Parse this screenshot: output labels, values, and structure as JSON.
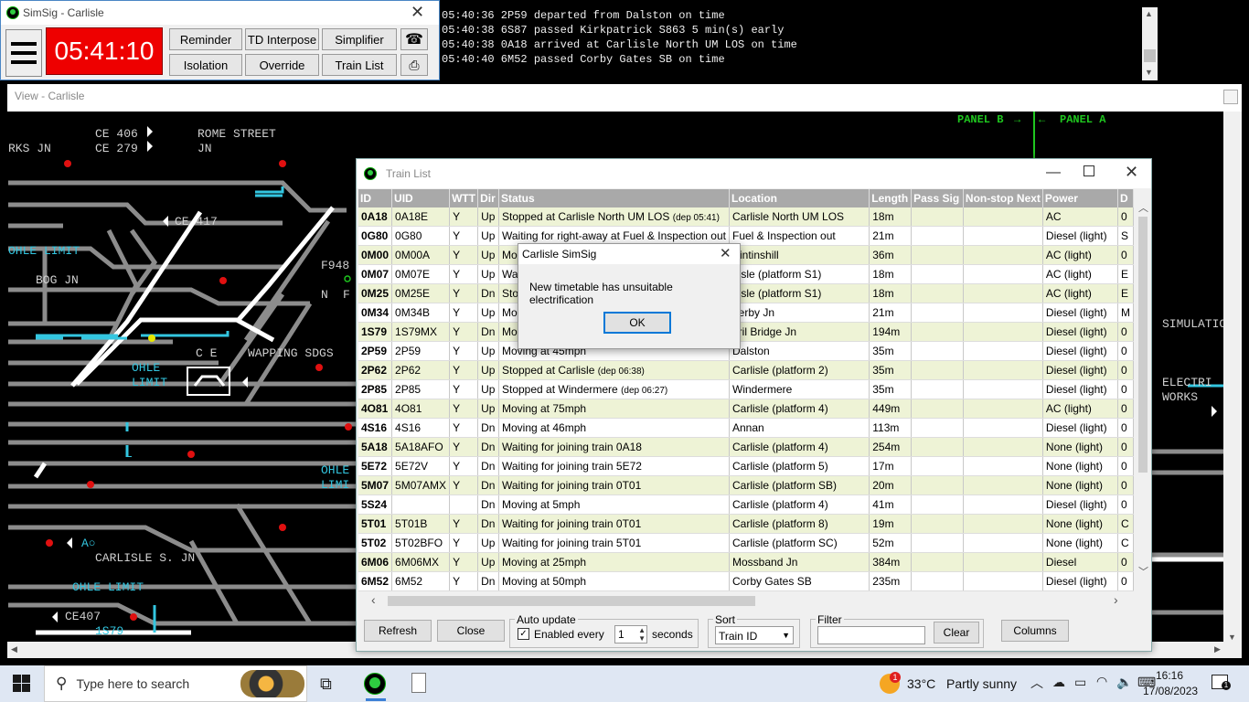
{
  "control": {
    "title": "SimSig - Carlisle",
    "clock": "05:41:10",
    "buttons": [
      "Reminder",
      "TD Interpose",
      "Simplifier",
      "Isolation",
      "Override",
      "Train List"
    ],
    "phone_icon": "telephone-icon",
    "printer_icon": "printer-icon"
  },
  "log": [
    "05:40:36 2P59 departed from Dalston on time",
    "05:40:38 6S87 passed Kirkpatrick S863 5 min(s) early",
    "05:40:38 0A18 arrived at Carlisle North UM LOS on time",
    "05:40:40 6M52 passed Corby Gates SB on time"
  ],
  "view": {
    "title": "View - Carlisle",
    "labels": {
      "panel_b": "PANEL B",
      "panel_a": "PANEL A",
      "rks_jn": "RKS JN",
      "ce406": "CE 406",
      "ce279": "CE 279",
      "rome_street": "ROME STREET",
      "jn": "JN",
      "ce417": "CE 417",
      "ohle_limit_1": "OHLE LIMIT",
      "bog_jn": "BOG JN",
      "f948": "F948",
      "n": "N",
      "f": "F",
      "ce": "C E",
      "wapping": "WAPPING SDGS",
      "ohle": "OHLE",
      "limit": "LIMIT",
      "ohle_limi": "OHLE",
      "limi": "LIMI",
      "l": "L",
      "ao": "A○",
      "carlisle_s_jn": "CARLISLE S. JN",
      "ohle_limit_2": "OHLE LIMIT",
      "ce407": "CE407",
      "s79": "1S79",
      "simulatio": "SIMULATIO",
      "electri": "ELECTRI",
      "works": "WORKS"
    },
    "colors": {
      "track": "#8c8c8c",
      "white": "#ffffff",
      "cyan": "#33c6e0",
      "green": "#1fc61f",
      "red": "#e01010",
      "yellow": "#e8e800"
    }
  },
  "trainlist": {
    "title": "Train List",
    "columns": [
      "ID",
      "UID",
      "WTT",
      "Dir",
      "Status",
      "Location",
      "Length",
      "Pass Sig",
      "Non-stop Next",
      "Power",
      "D"
    ],
    "rows": [
      {
        "id": "0A18",
        "uid": "0A18E",
        "wtt": "Y",
        "dir": "Up",
        "status": "Stopped at Carlisle North UM LOS",
        "extra": "(dep 05:41)",
        "location": "Carlisle North UM LOS",
        "length": "18m",
        "pass": "",
        "nonstop": "",
        "power": "AC",
        "d": "0"
      },
      {
        "id": "0G80",
        "uid": "0G80",
        "wtt": "Y",
        "dir": "Up",
        "status": "Waiting for right-away at Fuel & Inspection out",
        "extra": "",
        "location": "Fuel & Inspection out",
        "length": "21m",
        "pass": "",
        "nonstop": "",
        "power": "Diesel (light)",
        "d": "S"
      },
      {
        "id": "0M00",
        "uid": "0M00A",
        "wtt": "Y",
        "dir": "Up",
        "status": "Mo",
        "extra": "",
        "location": "Aintinshill",
        "length": "36m",
        "pass": "",
        "nonstop": "",
        "power": "AC (light)",
        "d": "0"
      },
      {
        "id": "0M07",
        "uid": "0M07E",
        "wtt": "Y",
        "dir": "Up",
        "status": "Wa",
        "extra": "",
        "location": "rlisle (platform S1)",
        "length": "18m",
        "pass": "",
        "nonstop": "",
        "power": "AC (light)",
        "d": "E"
      },
      {
        "id": "0M25",
        "uid": "0M25E",
        "wtt": "Y",
        "dir": "Dn",
        "status": "Sto",
        "extra": "",
        "location": "rlisle (platform S1)",
        "length": "18m",
        "pass": "",
        "nonstop": "",
        "power": "AC (light)",
        "d": "E"
      },
      {
        "id": "0M34",
        "uid": "0M34B",
        "wtt": "Y",
        "dir": "Up",
        "status": "Mo",
        "extra": "",
        "location": "nerby Jn",
        "length": "21m",
        "pass": "",
        "nonstop": "",
        "power": "Diesel (light)",
        "d": "M"
      },
      {
        "id": "1S79",
        "uid": "1S79MX",
        "wtt": "Y",
        "dir": "Dn",
        "status": "Mo",
        "extra": "",
        "location": "eril Bridge Jn",
        "length": "194m",
        "pass": "",
        "nonstop": "",
        "power": "Diesel (light)",
        "d": "0"
      },
      {
        "id": "2P59",
        "uid": "2P59",
        "wtt": "Y",
        "dir": "Up",
        "status": "Moving at 45mph",
        "extra": "",
        "location": "Dalston",
        "length": "35m",
        "pass": "",
        "nonstop": "",
        "power": "Diesel (light)",
        "d": "0"
      },
      {
        "id": "2P62",
        "uid": "2P62",
        "wtt": "Y",
        "dir": "Up",
        "status": "Stopped at Carlisle",
        "extra": "(dep 06:38)",
        "location": "Carlisle (platform 2)",
        "length": "35m",
        "pass": "",
        "nonstop": "",
        "power": "Diesel (light)",
        "d": "0"
      },
      {
        "id": "2P85",
        "uid": "2P85",
        "wtt": "Y",
        "dir": "Up",
        "status": "Stopped at Windermere",
        "extra": "(dep 06:27)",
        "location": "Windermere",
        "length": "35m",
        "pass": "",
        "nonstop": "",
        "power": "Diesel (light)",
        "d": "0"
      },
      {
        "id": "4O81",
        "uid": "4O81",
        "wtt": "Y",
        "dir": "Up",
        "status": "Moving at 75mph",
        "extra": "",
        "location": "Carlisle (platform 4)",
        "length": "449m",
        "pass": "",
        "nonstop": "",
        "power": "AC (light)",
        "d": "0"
      },
      {
        "id": "4S16",
        "uid": "4S16",
        "wtt": "Y",
        "dir": "Dn",
        "status": "Moving at 46mph",
        "extra": "",
        "location": "Annan",
        "length": "113m",
        "pass": "",
        "nonstop": "",
        "power": "Diesel (light)",
        "d": "0"
      },
      {
        "id": "5A18",
        "uid": "5A18AFO",
        "wtt": "Y",
        "dir": "Dn",
        "status": "Waiting for joining train 0A18",
        "extra": "",
        "location": "Carlisle (platform 4)",
        "length": "254m",
        "pass": "",
        "nonstop": "",
        "power": "None (light)",
        "d": "0"
      },
      {
        "id": "5E72",
        "uid": "5E72V",
        "wtt": "Y",
        "dir": "Dn",
        "status": "Waiting for joining train 5E72",
        "extra": "",
        "location": "Carlisle (platform 5)",
        "length": "17m",
        "pass": "",
        "nonstop": "",
        "power": "None (light)",
        "d": "0"
      },
      {
        "id": "5M07",
        "uid": "5M07AMX",
        "wtt": "Y",
        "dir": "Dn",
        "status": "Waiting for joining train 0T01",
        "extra": "",
        "location": "Carlisle (platform SB)",
        "length": "20m",
        "pass": "",
        "nonstop": "",
        "power": "None (light)",
        "d": "0"
      },
      {
        "id": "5S24",
        "uid": "",
        "wtt": "",
        "dir": "Dn",
        "status": "Moving at 5mph",
        "extra": "",
        "location": "Carlisle (platform 4)",
        "length": "41m",
        "pass": "",
        "nonstop": "",
        "power": "Diesel (light)",
        "d": "0"
      },
      {
        "id": "5T01",
        "uid": "5T01B",
        "wtt": "Y",
        "dir": "Dn",
        "status": "Waiting for joining train 0T01",
        "extra": "",
        "location": "Carlisle (platform 8)",
        "length": "19m",
        "pass": "",
        "nonstop": "",
        "power": "None (light)",
        "d": "C"
      },
      {
        "id": "5T02",
        "uid": "5T02BFO",
        "wtt": "Y",
        "dir": "Up",
        "status": "Waiting for joining train 5T01",
        "extra": "",
        "location": "Carlisle (platform SC)",
        "length": "52m",
        "pass": "",
        "nonstop": "",
        "power": "None (light)",
        "d": "C"
      },
      {
        "id": "6M06",
        "uid": "6M06MX",
        "wtt": "Y",
        "dir": "Up",
        "status": "Moving at 25mph",
        "extra": "",
        "location": "Mossband Jn",
        "length": "384m",
        "pass": "",
        "nonstop": "",
        "power": "Diesel",
        "d": "0"
      },
      {
        "id": "6M52",
        "uid": "6M52",
        "wtt": "Y",
        "dir": "Dn",
        "status": "Moving at 50mph",
        "extra": "",
        "location": "Corby Gates SB",
        "length": "235m",
        "pass": "",
        "nonstop": "",
        "power": "Diesel (light)",
        "d": "0"
      }
    ],
    "footer": {
      "refresh": "Refresh",
      "close": "Close",
      "auto_update": "Auto update",
      "enabled_every": "Enabled every",
      "interval": "1",
      "seconds": "seconds",
      "sort": "Sort",
      "sort_value": "Train ID",
      "filter": "Filter",
      "filter_value": "",
      "clear": "Clear",
      "columns": "Columns"
    }
  },
  "messagebox": {
    "title": "Carlisle SimSig",
    "message": "New timetable has unsuitable electrification",
    "ok": "OK"
  },
  "taskbar": {
    "search_placeholder": "Type here to search",
    "temperature": "33°C",
    "weather": "Partly sunny",
    "notification_count": "1",
    "time": "16:16",
    "date": "17/08/2023"
  }
}
